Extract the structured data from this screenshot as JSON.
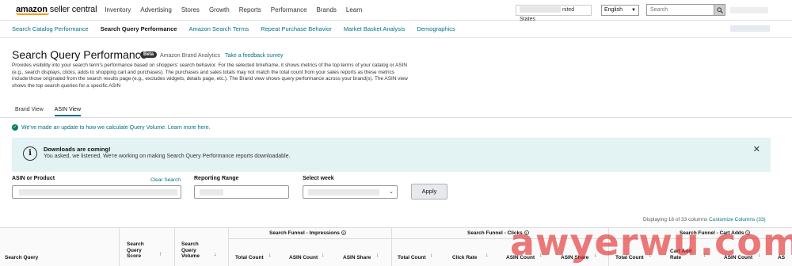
{
  "header": {
    "logo_main": "amazon",
    "logo_sub": "seller central",
    "menu": [
      "Inventory",
      "Advertising",
      "Stores",
      "Growth",
      "Reports",
      "Performance",
      "Brands",
      "Learn"
    ],
    "marketplace": "nited States",
    "language": "English",
    "search_placeholder": "Search"
  },
  "subnav": {
    "items": [
      "Search Catalog Performance",
      "Search Query Performance",
      "Amazon Search Terms",
      "Repeat Purchase Behavior",
      "Market Basket Analysis",
      "Demographics"
    ],
    "active_index": 1
  },
  "page": {
    "title": "Search Query Performance",
    "beta": "Beta",
    "brand_analytics": "Amazon Brand Analytics",
    "feedback": "Take a feedback survey",
    "description": "Provides visibility into your search term's performance based on shoppers' search behavior. For the selected timeframe, it shows metrics of the top terms of your catalog or ASIN (e.g., search displays, clicks, adds to shopping cart and purchases). The purchases and sales totals may not match the total count from your sales reports as these metrics include those originated from the search results page (e.g., excludes widgets, details page, etc.). The Brand view shows query performance across your brand(s). The ASIN view shows the top search queries for a specific ASIN"
  },
  "tabs": [
    "Brand View",
    "ASIN View"
  ],
  "update_note": "We've made an update to how we calculate Query Volume. Learn more here.",
  "banner": {
    "title": "Downloads are coming!",
    "text": "You asked, we listened. We're working on making Search Query Performance reports downloadable."
  },
  "filters": {
    "asin_label": "ASIN or Product",
    "clear_label": "Clear Search",
    "range_label": "Reporting Range",
    "week_label": "Select week",
    "apply": "Apply"
  },
  "table": {
    "displaying": "Displaying 18 of 33 columns",
    "customize": "Customize Columns (33)",
    "groups": [
      "Search Funnel - Impressions",
      "Search Funnel - Clicks",
      "Search Funnel - Cart Adds"
    ],
    "columns": {
      "search_query": "Search Query",
      "sq_score_1": "Search",
      "sq_score_2": "Query",
      "sq_score_3": "Score",
      "sq_volume_1": "Search",
      "sq_volume_2": "Query",
      "sq_volume_3": "Volume",
      "imp_total": "Total Count",
      "imp_asin_count": "ASIN Count",
      "imp_asin_share": "ASIN Share",
      "clk_total": "Total Count",
      "clk_rate": "Click Rate",
      "clk_asin_count": "ASIN Count",
      "clk_asin_share": "ASIN Share",
      "cart_total": "Total Count",
      "cart_rate_1": "Cart Add",
      "cart_rate_2": "Rate",
      "cart_asin_count": "ASIN Count",
      "cart_more": "AS"
    }
  },
  "watermark": "awyerwu.com"
}
